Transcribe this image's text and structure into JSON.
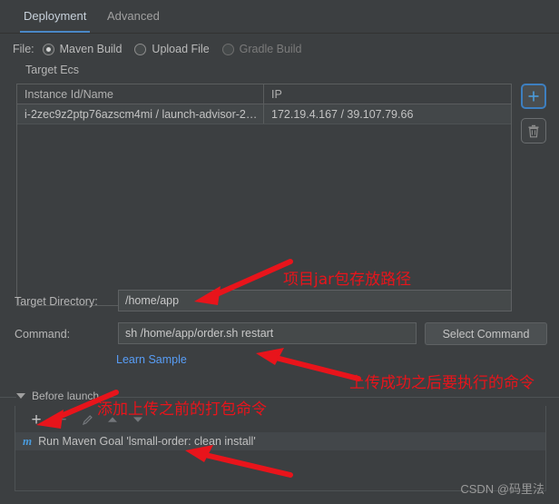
{
  "tabs": [
    {
      "label": "Deployment",
      "active": true
    },
    {
      "label": "Advanced",
      "active": false
    }
  ],
  "file_row": {
    "label": "File:",
    "options": [
      {
        "label": "Maven Build",
        "selected": true,
        "enabled": true
      },
      {
        "label": "Upload File",
        "selected": false,
        "enabled": true
      },
      {
        "label": "Gradle Build",
        "selected": false,
        "enabled": false
      }
    ]
  },
  "target_ecs": {
    "label": "Target Ecs",
    "columns": [
      "Instance Id/Name",
      "IP"
    ],
    "rows": [
      {
        "instance": "i-2zec9z2ptp76azscm4mi / launch-advisor-2…",
        "ip": "172.19.4.167 / 39.107.79.66"
      }
    ],
    "add_button_icon": "plus-icon",
    "delete_button_icon": "trash-icon"
  },
  "target_directory": {
    "label": "Target Directory:",
    "value": "/home/app"
  },
  "command": {
    "label": "Command:",
    "value": "sh /home/app/order.sh restart",
    "select_button": "Select Command",
    "learn_link": "Learn Sample"
  },
  "before_launch": {
    "title": "Before launch",
    "toolbar": [
      {
        "icon": "plus-icon",
        "enabled": true
      },
      {
        "icon": "minus-icon",
        "enabled": false
      },
      {
        "icon": "pencil-icon",
        "enabled": false
      },
      {
        "icon": "arrow-up-icon",
        "enabled": false
      },
      {
        "icon": "arrow-down-icon",
        "enabled": false
      }
    ],
    "items": [
      {
        "icon": "maven-icon",
        "label": "Run Maven Goal 'lsmall-order: clean install'"
      }
    ]
  },
  "annotations": [
    {
      "id": "anno-1",
      "text": "项目jar包存放路径"
    },
    {
      "id": "anno-2",
      "text": "上传成功之后要执行的命令"
    },
    {
      "id": "anno-3",
      "text": "添加上传之前的打包命令"
    }
  ],
  "watermark": "CSDN @码里法",
  "colors": {
    "background": "#3c3f41",
    "accent_blue": "#4a88c7",
    "link_blue": "#589df6",
    "annotation_red": "#e8141b",
    "field_background": "#45494a"
  }
}
